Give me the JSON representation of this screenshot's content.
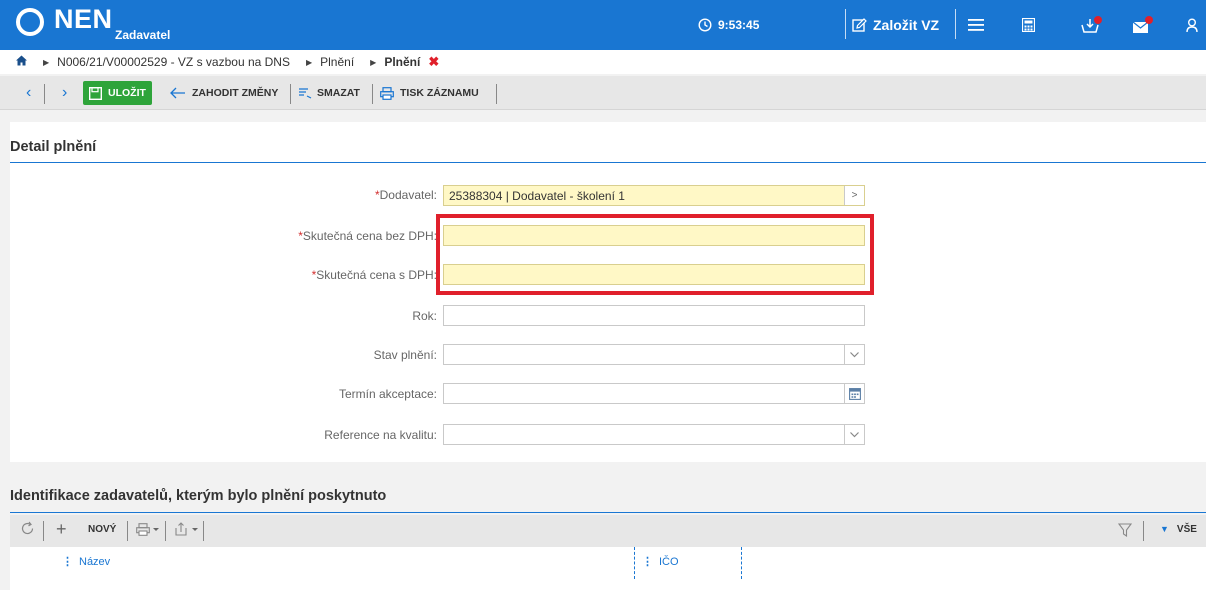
{
  "header": {
    "logo": "NEN",
    "logo_sub": "Zadavatel",
    "clock": "9:53:45",
    "create_label": "Založit VZ"
  },
  "breadcrumb": {
    "items": [
      "N006/21/V00002529 - VZ s vazbou na DNS",
      "Plnění",
      "Plnění"
    ]
  },
  "toolbar": {
    "save": "ULOŽIT",
    "discard": "ZAHODIT ZMĚNY",
    "delete": "SMAZAT",
    "print": "TISK ZÁZNAMU"
  },
  "detail": {
    "title": "Detail plnění",
    "fields": [
      {
        "label": "Dodavatel:",
        "required": "*",
        "value": "25388304 | Dodavatel - školení 1"
      },
      {
        "label": "Skutečná cena bez DPH:",
        "required": "*",
        "value": ""
      },
      {
        "label": "Skutečná cena s DPH:",
        "required": "*",
        "value": ""
      },
      {
        "label": "Rok:",
        "required": "",
        "value": ""
      },
      {
        "label": "Stav plnění:",
        "required": "",
        "value": ""
      },
      {
        "label": "Termín akceptace:",
        "required": "",
        "value": ""
      },
      {
        "label": "Reference na kvalitu:",
        "required": "",
        "value": ""
      }
    ]
  },
  "grid": {
    "title": "Identifikace zadavatelů, kterým bylo plnění poskytnuto",
    "new_label": "NOVÝ",
    "filter_label": "VŠE",
    "columns": [
      "Název",
      "IČO"
    ]
  },
  "colors": {
    "header_bg": "#1976d2",
    "save_green": "#2ea43a",
    "required_red": "#d32f2f",
    "highlight_red": "#e0202b",
    "input_yellow": "#fff8c6"
  }
}
